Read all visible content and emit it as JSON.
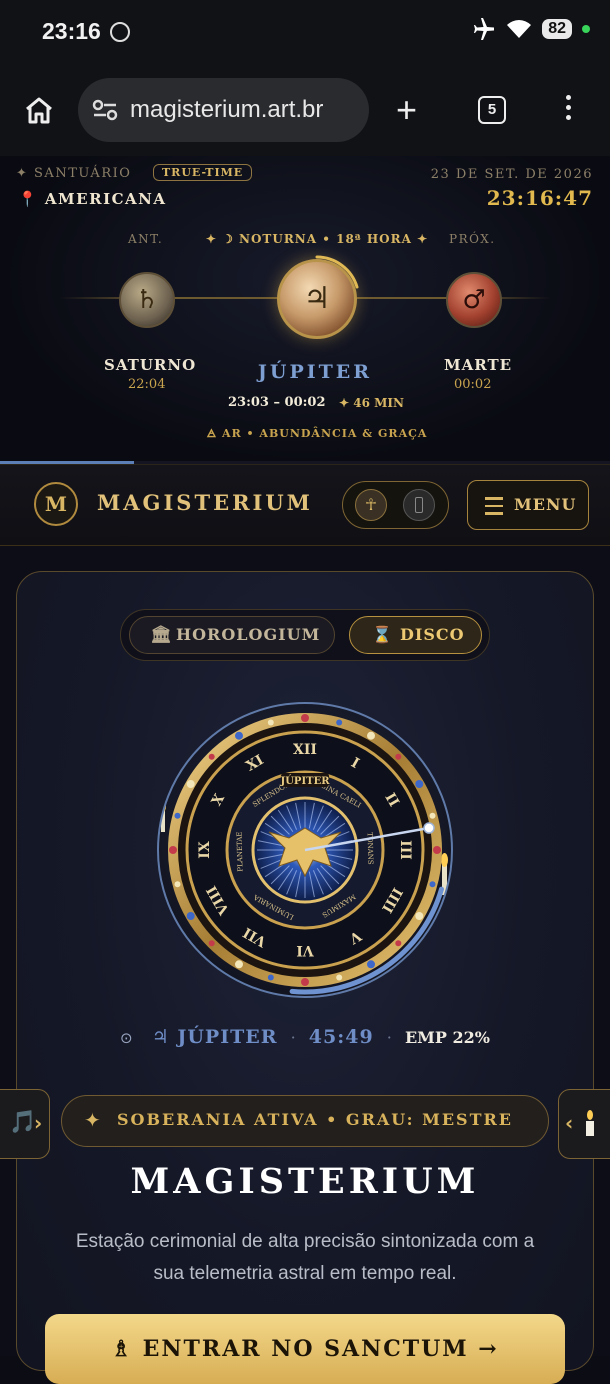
{
  "status_bar": {
    "time": "23:16",
    "battery": "82",
    "colors": {
      "wifi_dot": "#39d45a"
    }
  },
  "browser": {
    "url": "magisterium.art.br",
    "tab_count": "5"
  },
  "hour_panel": {
    "sanctuary_label": "SANTUÁRIO",
    "truetime_label": "TRUE-TIME",
    "city": "AMERICANA",
    "date": "23 DE SET. DE 2026",
    "clock": "23:16:47",
    "prev_label": "ANT.",
    "next_label": "PRÓX.",
    "hour_label": "✦ ☽ NOTURNA • 18ª HORA ✦",
    "previous": {
      "name": "SATURNO",
      "time": "22:04",
      "glyph": "♄"
    },
    "current": {
      "name": "JÚPITER",
      "range": "23:03 – 00:02",
      "remaining": "✦ 46 MIN",
      "glyph": "♃",
      "element": "🜁 AR • ABUNDÂNCIA & GRAÇA"
    },
    "next": {
      "name": "MARTE",
      "time": "00:02",
      "glyph": "♂"
    },
    "page_progress": 0.22
  },
  "nav": {
    "logo_letter": "M",
    "logo_text": "MAGISTERIUM",
    "toggle_a_glyph": "☥",
    "menu_label": "MENU"
  },
  "segmented": {
    "tab_a": {
      "label": "HOROLOGIUM",
      "icon": "🏛"
    },
    "tab_b": {
      "label": "DISCO",
      "icon": "⌛"
    }
  },
  "disc": {
    "banner_inner": "JÚPITER",
    "ring_words": [
      "REGINA CAELI",
      "TONANS",
      "MAXIMUS",
      "LUMINARIA",
      "PLANETAE",
      "SPLENDOR"
    ],
    "numerals": [
      "XII",
      "I",
      "II",
      "III",
      "IIII",
      "V",
      "VI",
      "VII",
      "VIII",
      "IX",
      "X",
      "XI"
    ],
    "progress": 0.22
  },
  "readout": {
    "sun_icon": "⊙",
    "planet": "♃ JÚPITER",
    "time": "45:49",
    "emp": "EMP 22%"
  },
  "side_left": {
    "icon": "🎵",
    "chevron": "›"
  },
  "side_right": {
    "chevron": "‹"
  },
  "banner": {
    "star": "✦",
    "text": "SOBERANIA ATIVA • GRAU: MESTRE"
  },
  "hero": {
    "title": "MAGISTERIUM",
    "description": "Estação cerimonial de alta precisão sintonizada com a sua telemetria astral em tempo real."
  },
  "cta": {
    "label": "♗ ENTRAR NO SANCTUM →"
  }
}
